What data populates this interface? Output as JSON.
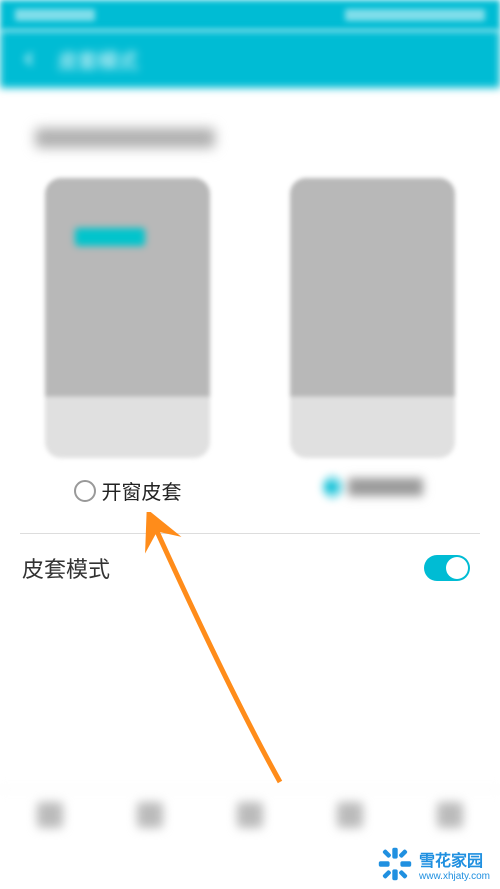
{
  "statusBar": {
    "leftText": "",
    "rightText": ""
  },
  "appBar": {
    "title": "皮套模式"
  },
  "subtitle": "",
  "options": {
    "left": {
      "label": "开窗皮套",
      "selected": false
    },
    "right": {
      "label": "",
      "selected": true
    }
  },
  "toggle": {
    "label": "皮套模式",
    "enabled": true
  },
  "watermark": {
    "title": "雪花家园",
    "url": "www.xhjaty.com"
  },
  "colors": {
    "primary": "#00bcd4",
    "arrow": "#ff8c1a",
    "watermark": "#2090e0"
  }
}
